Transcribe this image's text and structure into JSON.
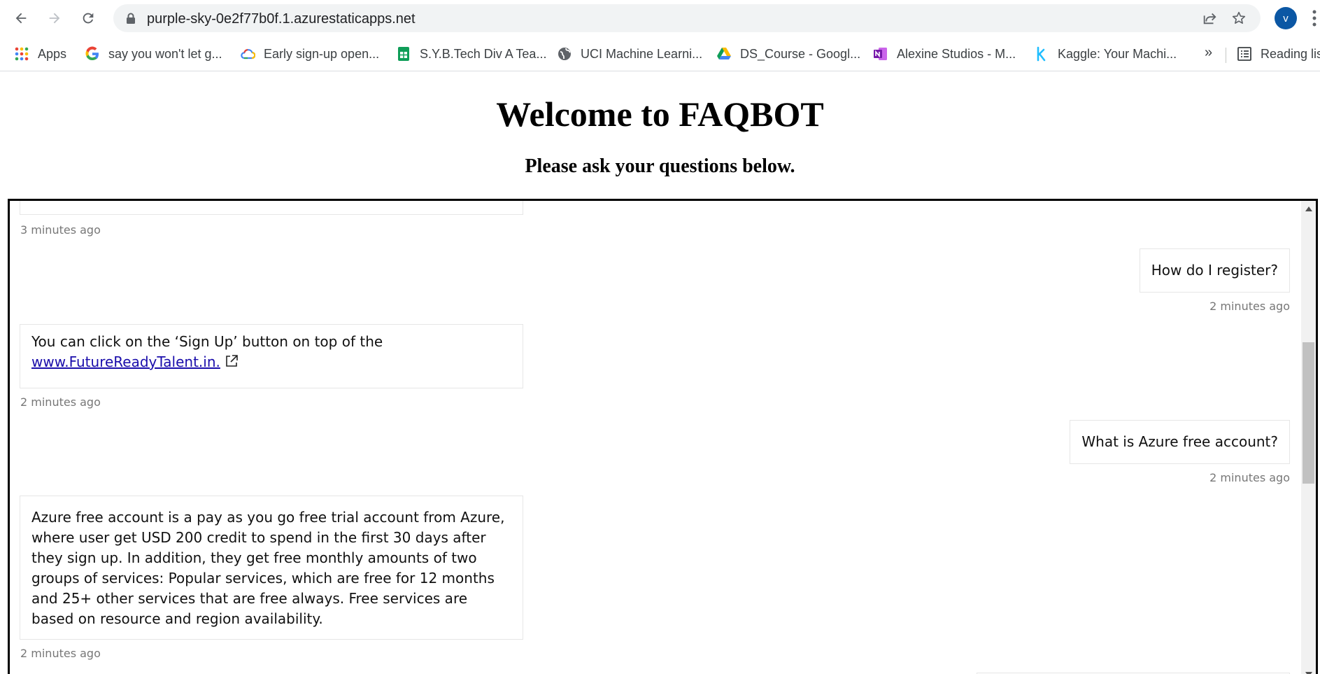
{
  "browser": {
    "url": "purple-sky-0e2f77b0f.1.azurestaticapps.net",
    "profile_initial": "v",
    "bookmarks": [
      {
        "label": "Apps",
        "icon": "apps-grid-icon"
      },
      {
        "label": "say you won't let g...",
        "icon": "google-icon"
      },
      {
        "label": "Early sign-up open...",
        "icon": "cloud-icon"
      },
      {
        "label": "S.Y.B.Tech Div A Tea...",
        "icon": "sheets-icon"
      },
      {
        "label": "UCI Machine Learni...",
        "icon": "globe-icon"
      },
      {
        "label": "DS_Course - Googl...",
        "icon": "drive-icon"
      },
      {
        "label": "Alexine Studios - M...",
        "icon": "onenote-icon"
      },
      {
        "label": "Kaggle: Your Machi...",
        "icon": "kaggle-icon"
      }
    ],
    "more_label": "»",
    "reading_list_label": "Reading list"
  },
  "page": {
    "title": "Welcome to FAQBOT",
    "subtitle": "Please ask your questions below."
  },
  "chat": {
    "messages": [
      {
        "from": "bot",
        "text": "",
        "time": "3 minutes ago"
      },
      {
        "from": "user",
        "text": "How do I register?",
        "time": "2 minutes ago"
      },
      {
        "from": "bot",
        "text": "You can click on the ‘Sign Up’ button on top of the",
        "link": "www.FutureReadyTalent.in.",
        "time": "2 minutes ago"
      },
      {
        "from": "user",
        "text": "What is Azure free account?",
        "time": "2 minutes ago"
      },
      {
        "from": "bot",
        "text": "Azure free account is a pay as you go free trial account from Azure, where user get USD 200 credit to spend in the first 30 days after they sign up. In addition, they get free monthly amounts of two groups of services: Popular services, which are free for 12 months and 25+ other services that are free always. Free services are based on resource and region availability.",
        "time": "2 minutes ago"
      }
    ]
  },
  "colors": {
    "avatar": "#0b57a4",
    "link": "#1a0dab",
    "timestamp": "#777777",
    "bubble_border": "#e6e6e6"
  }
}
